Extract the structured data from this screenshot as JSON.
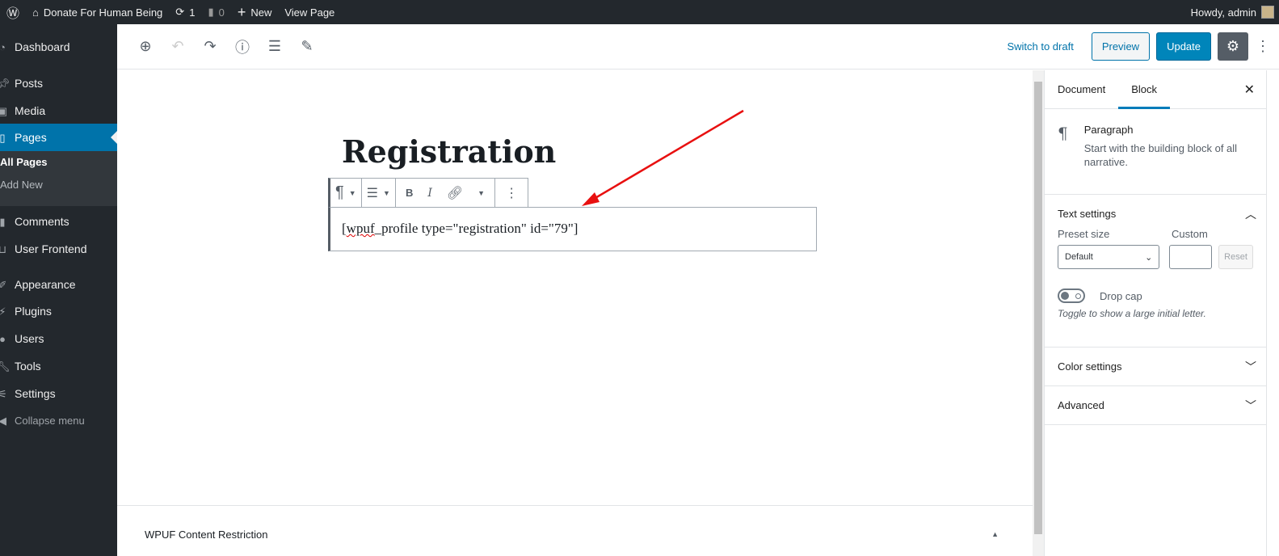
{
  "adminbar": {
    "site": "Donate For Human Being",
    "updates": "1",
    "comments": "0",
    "new": "New",
    "view": "View Page",
    "howdy": "Howdy, admin"
  },
  "sidebar": {
    "items": [
      {
        "label": "Dashboard",
        "icon": "dashboard-icon"
      },
      {
        "label": "Posts",
        "icon": "pin-icon"
      },
      {
        "label": "Media",
        "icon": "media-icon"
      },
      {
        "label": "Pages",
        "icon": "page-icon",
        "active": true
      },
      {
        "label": "Comments",
        "icon": "comment-icon"
      },
      {
        "label": "User Frontend",
        "icon": "user-frontend-icon"
      },
      {
        "label": "Appearance",
        "icon": "brush-icon"
      },
      {
        "label": "Plugins",
        "icon": "plugin-icon"
      },
      {
        "label": "Users",
        "icon": "users-icon"
      },
      {
        "label": "Tools",
        "icon": "wrench-icon"
      },
      {
        "label": "Settings",
        "icon": "settings-icon"
      },
      {
        "label": "Collapse menu",
        "icon": "collapse-icon"
      }
    ],
    "submenu": [
      "All Pages",
      "Add New"
    ]
  },
  "header": {
    "switch_draft": "Switch to draft",
    "preview": "Preview",
    "update": "Update"
  },
  "editor": {
    "title": "Registration",
    "paragraph_prefix": "[",
    "paragraph_squiggle": "wpuf",
    "paragraph_rest": "_profile type=\"registration\" id=\"79\"]",
    "bold": "B",
    "italic": "I"
  },
  "metabox": {
    "title": "WPUF Content Restriction"
  },
  "panel": {
    "tabs": [
      "Document",
      "Block"
    ],
    "block_name": "Paragraph",
    "block_desc": "Start with the building block of all narrative.",
    "text_settings": "Text settings",
    "preset_label": "Preset size",
    "custom_label": "Custom",
    "preset_value": "Default",
    "reset": "Reset",
    "drop_cap": "Drop cap",
    "drop_cap_help": "Toggle to show a large initial letter.",
    "drop_cap_on": false,
    "color_settings": "Color settings",
    "advanced": "Advanced"
  },
  "colors": {
    "accent": "#0073aa",
    "adminbar": "#23282d",
    "arrow": "#e81010"
  }
}
